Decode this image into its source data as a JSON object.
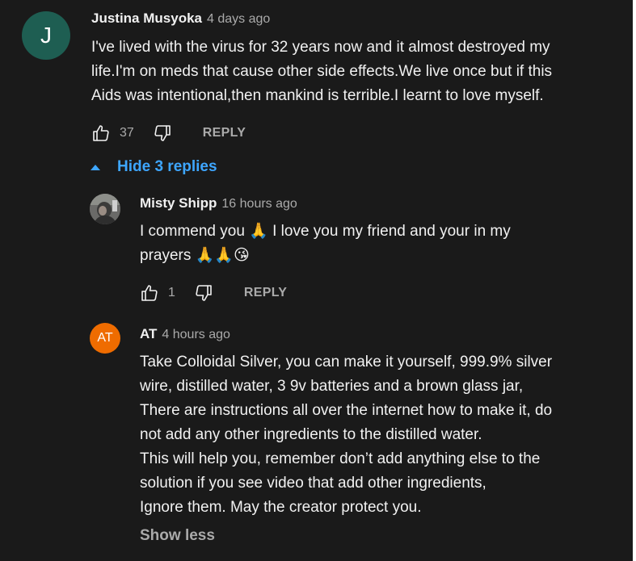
{
  "comments": [
    {
      "author": "Justina Musyoka",
      "time": "4 days ago",
      "avatar_letter": "J",
      "avatar_color": "#1e5e52",
      "lines": [
        "I've lived with the virus for 32 years  now and it almost destroyed my",
        "life.I'm on meds that cause other side effects.We live once but if this",
        "Aids was intentional,then mankind is terrible.I learnt to love myself."
      ],
      "likes": "37",
      "reply_label": "REPLY"
    }
  ],
  "replies_toggle": {
    "label": "Hide 3 replies",
    "icon": "caret-up-icon"
  },
  "replies": [
    {
      "author": "Misty Shipp",
      "time": "16 hours ago",
      "avatar": "profile-photo",
      "line1": "I commend you 🙏 I love you my friend and your in my",
      "line2": "prayers 🙏🙏😘",
      "likes": "1",
      "reply_label": "REPLY"
    },
    {
      "author": "AT",
      "time": "4 hours ago",
      "avatar_letter": "AT",
      "avatar_color": "#ef6c00",
      "lines": [
        "Take Colloidal Silver, you can make it yourself, 999.9% silver",
        "wire, distilled water, 3 9v batteries and a brown glass jar,",
        "There are instructions all over the internet how to make it, do",
        "not add any other ingredients to the distilled water.",
        "This will help you, remember don’t add anything else to the",
        "solution if you see video that add other ingredients,",
        "Ignore them. May the creator protect you."
      ],
      "show_less": "Show less"
    }
  ],
  "colors": {
    "background": "#1a1a1a",
    "link": "#3ea6ff",
    "muted": "#aaaaaa"
  }
}
